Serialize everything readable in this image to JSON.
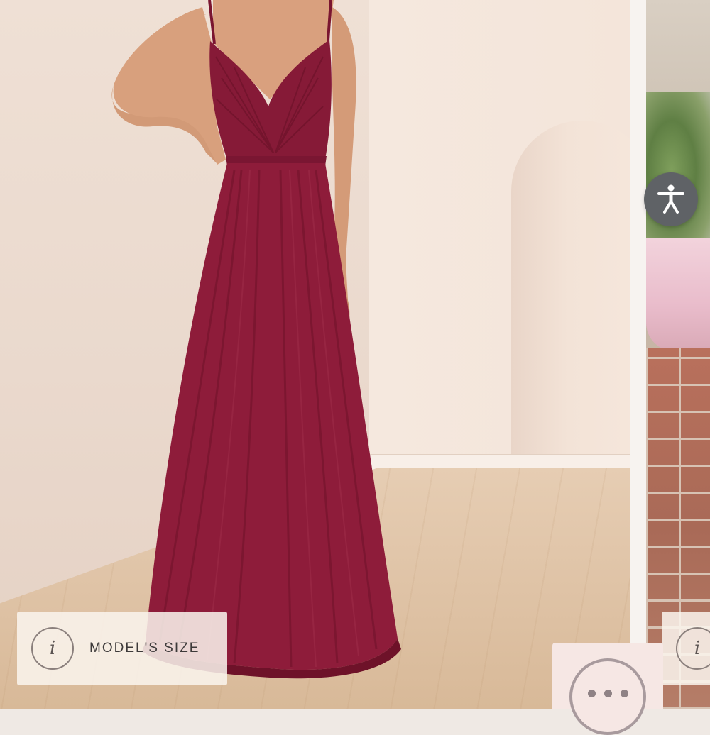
{
  "gallery": {
    "main_image": {
      "alt": "Burgundy maxi dress"
    },
    "model_size_chip": {
      "info_icon": "info-icon",
      "info_glyph": "i",
      "label": "MODEL'S SIZE"
    },
    "next_image": {
      "info_glyph": "i"
    }
  },
  "floating": {
    "accessibility": {
      "icon": "accessibility-person-icon"
    },
    "chat": {
      "icon": "chat-ellipsis-icon"
    }
  },
  "colors": {
    "dress": "#8e1c3a",
    "chip_bg": "#faf4ee",
    "a11y_bg": "#5f6266",
    "chat_bg": "#f6e7e4"
  }
}
